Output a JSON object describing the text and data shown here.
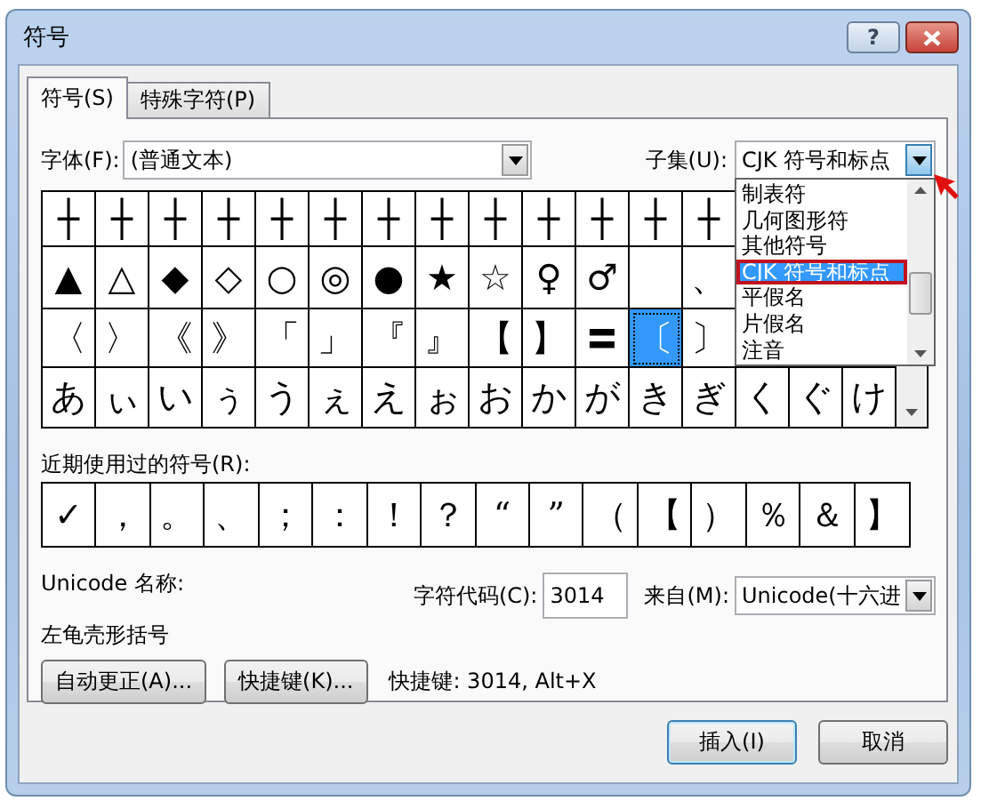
{
  "window": {
    "title": "符号",
    "help": "?"
  },
  "tabs": [
    {
      "label": "符号(S)",
      "selected": true
    },
    {
      "label": "特殊字符(P)",
      "selected": false
    }
  ],
  "font": {
    "label": "字体(F):",
    "value": "(普通文本)"
  },
  "subset": {
    "label": "子集(U):",
    "value": "CJK 符号和标点",
    "open": true,
    "options": [
      {
        "label": "制表符",
        "selected": false
      },
      {
        "label": "几何图形符",
        "selected": false
      },
      {
        "label": "其他符号",
        "selected": false
      },
      {
        "label": "CJK 符号和标点",
        "selected": true
      },
      {
        "label": "平假名",
        "selected": false
      },
      {
        "label": "片假名",
        "selected": false
      },
      {
        "label": "注音",
        "selected": false
      }
    ]
  },
  "symbol_grid": {
    "rows": [
      [
        {
          "char": "┼",
          "selected": false
        },
        {
          "char": "┼",
          "selected": false
        },
        {
          "char": "┼",
          "selected": false
        },
        {
          "char": "┼",
          "selected": false
        },
        {
          "char": "┼",
          "selected": false
        },
        {
          "char": "┼",
          "selected": false
        },
        {
          "char": "┼",
          "selected": false
        },
        {
          "char": "┼",
          "selected": false
        },
        {
          "char": "┼",
          "selected": false
        },
        {
          "char": "┼",
          "selected": false
        },
        {
          "char": "┼",
          "selected": false
        },
        {
          "char": "┼",
          "selected": false
        },
        {
          "char": "┼",
          "selected": false
        }
      ],
      [
        {
          "char": "▲",
          "selected": false
        },
        {
          "char": "△",
          "selected": false
        },
        {
          "char": "◆",
          "selected": false
        },
        {
          "char": "◇",
          "selected": false
        },
        {
          "char": "○",
          "selected": false
        },
        {
          "char": "◎",
          "selected": false
        },
        {
          "char": "●",
          "selected": false
        },
        {
          "char": "★",
          "selected": false
        },
        {
          "char": "☆",
          "selected": false
        },
        {
          "char": "♀",
          "selected": false
        },
        {
          "char": "♂",
          "selected": false
        },
        null,
        {
          "char": "、",
          "selected": false
        }
      ],
      [
        {
          "char": "〈",
          "selected": false
        },
        {
          "char": "〉",
          "selected": false
        },
        {
          "char": "《",
          "selected": false
        },
        {
          "char": "》",
          "selected": false
        },
        {
          "char": "「",
          "selected": false
        },
        {
          "char": "」",
          "selected": false
        },
        {
          "char": "『",
          "selected": false
        },
        {
          "char": "』",
          "selected": false
        },
        {
          "char": "【",
          "selected": false
        },
        {
          "char": "】",
          "selected": false
        },
        {
          "char": "〓",
          "selected": false
        },
        {
          "char": "〔",
          "selected": true
        },
        {
          "char": "〕",
          "selected": false
        }
      ],
      [
        {
          "char": "あ",
          "selected": false
        },
        {
          "char": "ぃ",
          "selected": false
        },
        {
          "char": "い",
          "selected": false
        },
        {
          "char": "ぅ",
          "selected": false
        },
        {
          "char": "う",
          "selected": false
        },
        {
          "char": "ぇ",
          "selected": false
        },
        {
          "char": "え",
          "selected": false
        },
        {
          "char": "ぉ",
          "selected": false
        },
        {
          "char": "お",
          "selected": false
        },
        {
          "char": "か",
          "selected": false
        },
        {
          "char": "が",
          "selected": false
        },
        {
          "char": "き",
          "selected": false
        },
        {
          "char": "ぎ",
          "selected": false
        },
        {
          "char": "く",
          "selected": false
        },
        {
          "char": "ぐ",
          "selected": false
        },
        {
          "char": "け",
          "selected": false
        }
      ]
    ]
  },
  "recent": {
    "label": "近期使用过的符号(R):",
    "symbols": [
      "✓",
      "，",
      "。",
      "、",
      "；",
      "：",
      "！",
      "？",
      "“",
      "”",
      "（",
      "【",
      "）",
      "％",
      "＆",
      "】"
    ]
  },
  "unicode_name": {
    "label": "Unicode 名称:",
    "value": "左龟壳形括号"
  },
  "char_code": {
    "label": "字符代码(C):",
    "value": "3014"
  },
  "from": {
    "label": "来自(M):",
    "value": "Unicode(十六进"
  },
  "buttons": [
    {
      "label": "自动更正(A)..."
    },
    {
      "label": "快捷键(K)..."
    }
  ],
  "shortcut_text": "快捷键: 3014, Alt+X",
  "dialog_buttons": [
    {
      "label": "插入(I)",
      "default": true
    },
    {
      "label": "取消",
      "default": false
    }
  ]
}
